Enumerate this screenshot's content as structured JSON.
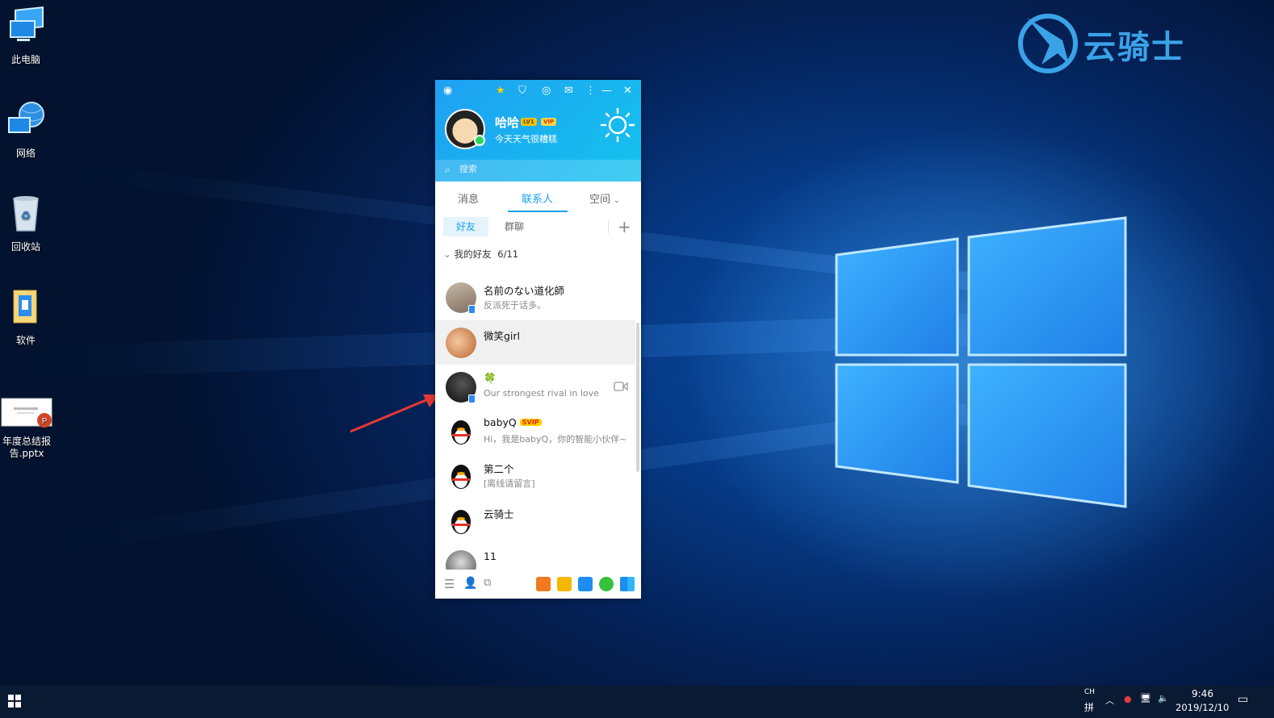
{
  "desktop": {
    "icons": [
      {
        "label": "此电脑"
      },
      {
        "label": "网络"
      },
      {
        "label": "回收站"
      },
      {
        "label": "软件"
      },
      {
        "label": "年度总结报告.pptx"
      }
    ]
  },
  "watermark": {
    "text": "云骑士"
  },
  "qq": {
    "profile": {
      "nickname": "哈哈",
      "badge_level": "LV1",
      "badge_vip": "VIP",
      "signature": "今天天气很糟糕"
    },
    "search": {
      "placeholder": "搜索"
    },
    "tabs": [
      {
        "label": "消息"
      },
      {
        "label": "联系人"
      },
      {
        "label": "空间"
      }
    ],
    "active_tab": "联系人",
    "subtabs": [
      {
        "label": "好友"
      },
      {
        "label": "群聊"
      }
    ],
    "group": {
      "name": "我的好友",
      "count": "6/11"
    },
    "contacts": [
      {
        "name": "名前のない道化師",
        "status": "反派死于话多。"
      },
      {
        "name": "微笑girl",
        "status": ""
      },
      {
        "name": "🍀",
        "status": "Our  strongest  rival  in  love"
      },
      {
        "name": "babyQ",
        "badge": "SVIP",
        "status": "Hi，我是babyQ，你的智能小伙伴~"
      },
      {
        "name": "第二个",
        "status": "[离线请留言]"
      },
      {
        "name": "云骑士",
        "status": ""
      },
      {
        "name": "11",
        "status": ""
      }
    ]
  },
  "taskbar": {
    "lang_top": "CH",
    "lang_bottom": "拼",
    "time": "9:46",
    "date": "2019/12/10"
  },
  "colors": {
    "accent": "#12a4f0",
    "header_start": "#1ea0f2",
    "header_end": "#15c3ee"
  }
}
